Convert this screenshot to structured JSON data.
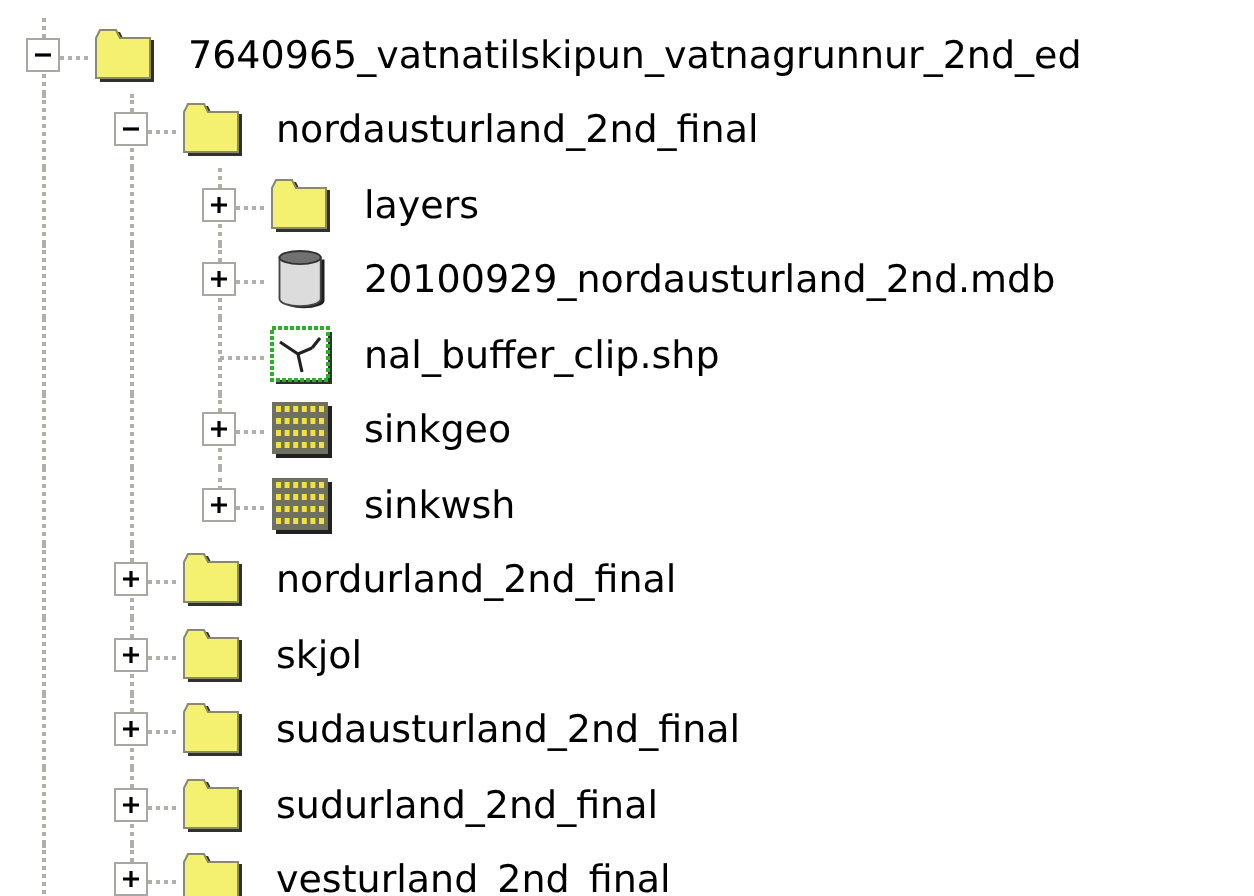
{
  "tree": [
    {
      "label": "7640965_vatnatilskipun_vatnagrunnur_2nd_ed",
      "kind": "folder",
      "expanded": true,
      "children": [
        {
          "label": "nordausturland_2nd_final",
          "kind": "folder",
          "expanded": true,
          "children": [
            {
              "label": "layers",
              "kind": "folder",
              "expanded": false
            },
            {
              "label": "20100929_nordausturland_2nd.mdb",
              "kind": "database",
              "expanded": false
            },
            {
              "label": "nal_buffer_clip.shp",
              "kind": "shapefile"
            },
            {
              "label": "sinkgeo",
              "kind": "raster",
              "expanded": false
            },
            {
              "label": "sinkwsh",
              "kind": "raster",
              "expanded": false
            }
          ]
        },
        {
          "label": "nordurland_2nd_final",
          "kind": "folder",
          "expanded": false
        },
        {
          "label": "skjol",
          "kind": "folder",
          "expanded": false
        },
        {
          "label": "sudausturland_2nd_final",
          "kind": "folder",
          "expanded": false
        },
        {
          "label": "sudurland_2nd_final",
          "kind": "folder",
          "expanded": false
        },
        {
          "label": "vesturland_2nd_final",
          "kind": "folder",
          "expanded": false
        }
      ]
    }
  ]
}
